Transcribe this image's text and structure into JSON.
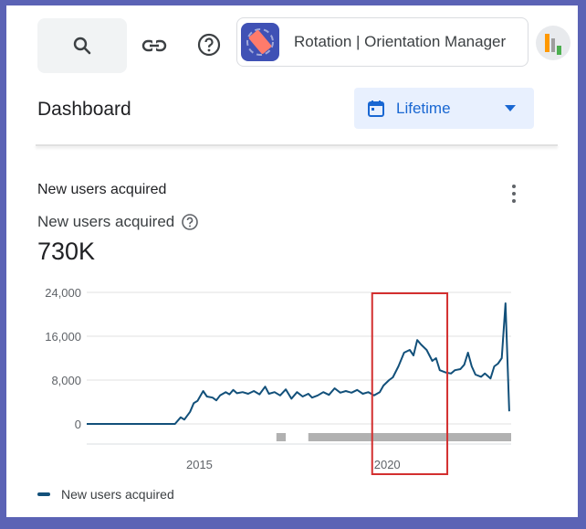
{
  "header": {
    "app_name": "Rotation | Orientation Manager",
    "icons": [
      "search-icon",
      "link-icon",
      "help-icon"
    ]
  },
  "page": {
    "title": "Dashboard",
    "date_range": "Lifetime"
  },
  "card": {
    "title": "New users acquired",
    "metric_label": "New users acquired",
    "metric_value": "730K"
  },
  "chart_data": {
    "type": "line",
    "series": [
      {
        "name": "New users acquired",
        "color": "#12507a",
        "points": [
          [
            2012.0,
            0
          ],
          [
            2013.0,
            0
          ],
          [
            2014.0,
            0
          ],
          [
            2014.35,
            0
          ],
          [
            2014.5,
            1200
          ],
          [
            2014.6,
            800
          ],
          [
            2014.75,
            2200
          ],
          [
            2014.85,
            3800
          ],
          [
            2014.95,
            4200
          ],
          [
            2015.1,
            6000
          ],
          [
            2015.2,
            5000
          ],
          [
            2015.35,
            4800
          ],
          [
            2015.45,
            4300
          ],
          [
            2015.55,
            5200
          ],
          [
            2015.7,
            5800
          ],
          [
            2015.8,
            5400
          ],
          [
            2015.9,
            6200
          ],
          [
            2016.0,
            5600
          ],
          [
            2016.15,
            5800
          ],
          [
            2016.3,
            5500
          ],
          [
            2016.45,
            6000
          ],
          [
            2016.6,
            5400
          ],
          [
            2016.75,
            6800
          ],
          [
            2016.85,
            5500
          ],
          [
            2017.0,
            5800
          ],
          [
            2017.15,
            5200
          ],
          [
            2017.3,
            6300
          ],
          [
            2017.45,
            4600
          ],
          [
            2017.6,
            5800
          ],
          [
            2017.75,
            5000
          ],
          [
            2017.9,
            5500
          ],
          [
            2018.0,
            4800
          ],
          [
            2018.15,
            5200
          ],
          [
            2018.3,
            5800
          ],
          [
            2018.45,
            5300
          ],
          [
            2018.6,
            6500
          ],
          [
            2018.75,
            5700
          ],
          [
            2018.9,
            6000
          ],
          [
            2019.05,
            5700
          ],
          [
            2019.2,
            6200
          ],
          [
            2019.35,
            5500
          ],
          [
            2019.5,
            5800
          ],
          [
            2019.65,
            5200
          ],
          [
            2019.8,
            5800
          ],
          [
            2019.9,
            7000
          ],
          [
            2020.05,
            8000
          ],
          [
            2020.15,
            8500
          ],
          [
            2020.3,
            10500
          ],
          [
            2020.45,
            13000
          ],
          [
            2020.6,
            13500
          ],
          [
            2020.7,
            12500
          ],
          [
            2020.8,
            15300
          ],
          [
            2020.9,
            14500
          ],
          [
            2021.05,
            13500
          ],
          [
            2021.2,
            11500
          ],
          [
            2021.3,
            12000
          ],
          [
            2021.4,
            9800
          ],
          [
            2021.55,
            9400
          ],
          [
            2021.7,
            9200
          ],
          [
            2021.8,
            9800
          ],
          [
            2021.95,
            10000
          ],
          [
            2022.05,
            10800
          ],
          [
            2022.15,
            13000
          ],
          [
            2022.25,
            10500
          ],
          [
            2022.35,
            9000
          ],
          [
            2022.5,
            8600
          ],
          [
            2022.6,
            9200
          ],
          [
            2022.75,
            8300
          ],
          [
            2022.85,
            10500
          ],
          [
            2022.95,
            11000
          ],
          [
            2023.05,
            12000
          ],
          [
            2023.15,
            22000
          ],
          [
            2023.25,
            2300
          ]
        ]
      }
    ],
    "xlim": [
      2012.0,
      2023.3
    ],
    "ylim": [
      0,
      24000
    ],
    "yticks": [
      "24,000",
      "16,000",
      "8,000",
      "0"
    ],
    "ytick_values": [
      24000,
      16000,
      8000,
      0
    ],
    "xticks": [
      "2015",
      "2020"
    ],
    "xtick_values": [
      2015,
      2020
    ],
    "grid": true,
    "legend_position": "bottom-left",
    "annotation": {
      "type": "highlight-rectangle",
      "color": "#d32f2f",
      "x_range": [
        2019.6,
        2021.6
      ]
    }
  }
}
